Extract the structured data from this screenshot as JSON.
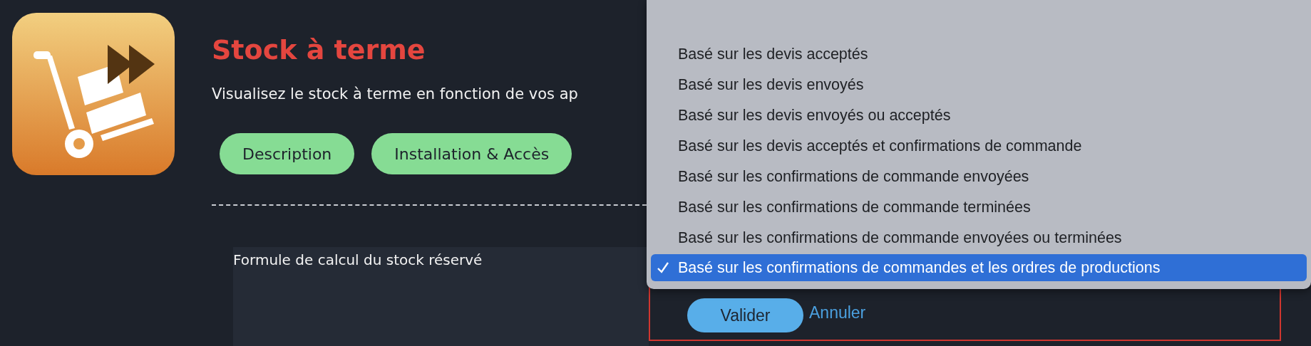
{
  "app": {
    "title": "Stock à terme",
    "description": "Visualisez le stock à terme en fonction de vos ap"
  },
  "tabs": [
    {
      "label": "Description"
    },
    {
      "label": "Installation & Accès"
    }
  ],
  "form": {
    "label": "Formule de calcul du stock réservé"
  },
  "menu": {
    "items": [
      {
        "label": "Basé sur les devis acceptés",
        "selected": false
      },
      {
        "label": "Basé sur les devis envoyés",
        "selected": false
      },
      {
        "label": "Basé sur les devis envoyés ou acceptés",
        "selected": false
      },
      {
        "label": "Basé sur les devis acceptés et confirmations de commande",
        "selected": false
      },
      {
        "label": "Basé sur les confirmations de commande envoyées",
        "selected": false
      },
      {
        "label": "Basé sur les confirmations de commande terminées",
        "selected": false
      },
      {
        "label": "Basé sur les confirmations de commande envoyées ou terminées",
        "selected": false
      },
      {
        "label": "Basé sur les confirmations de commandes et les ordres de productions",
        "selected": true
      }
    ]
  },
  "buttons": {
    "confirm": "Valider",
    "cancel": "Annuler"
  }
}
